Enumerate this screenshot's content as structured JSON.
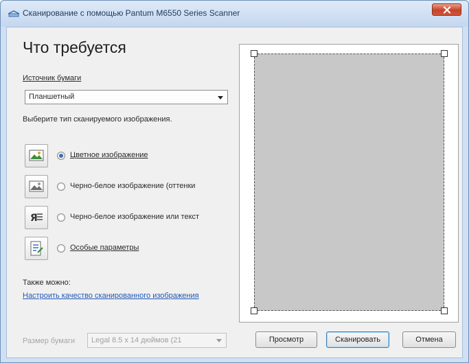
{
  "window": {
    "title": "Сканирование с помощью Pantum M6550 Series Scanner",
    "accent": "#c7432a"
  },
  "left_panel": {
    "heading": "Что требуется",
    "source_label": "Источник бумаги",
    "source_value": "Планшетный",
    "type_prompt": "Выберите тип сканируемого изображения.",
    "options": [
      {
        "icon": "color-picture-icon",
        "label": "Цветное изображение",
        "checked": true
      },
      {
        "icon": "grayscale-picture-icon",
        "label": "Черно-белое изображение (оттенки",
        "checked": false
      },
      {
        "icon": "bw-text-icon",
        "label": "Черно-белое изображение или текст",
        "checked": false
      },
      {
        "icon": "custom-settings-icon",
        "label": "Особые параметры",
        "checked": false
      }
    ],
    "also_label": "Также можно:",
    "quality_link": "Настроить качество сканированного изображения"
  },
  "bottom": {
    "page_size_label": "Размер бумаги",
    "page_size_value": "Legal 8.5 x 14 дюймов (21",
    "preview_button": "Просмотр",
    "scan_button": "Сканировать",
    "cancel_button": "Отмена"
  }
}
